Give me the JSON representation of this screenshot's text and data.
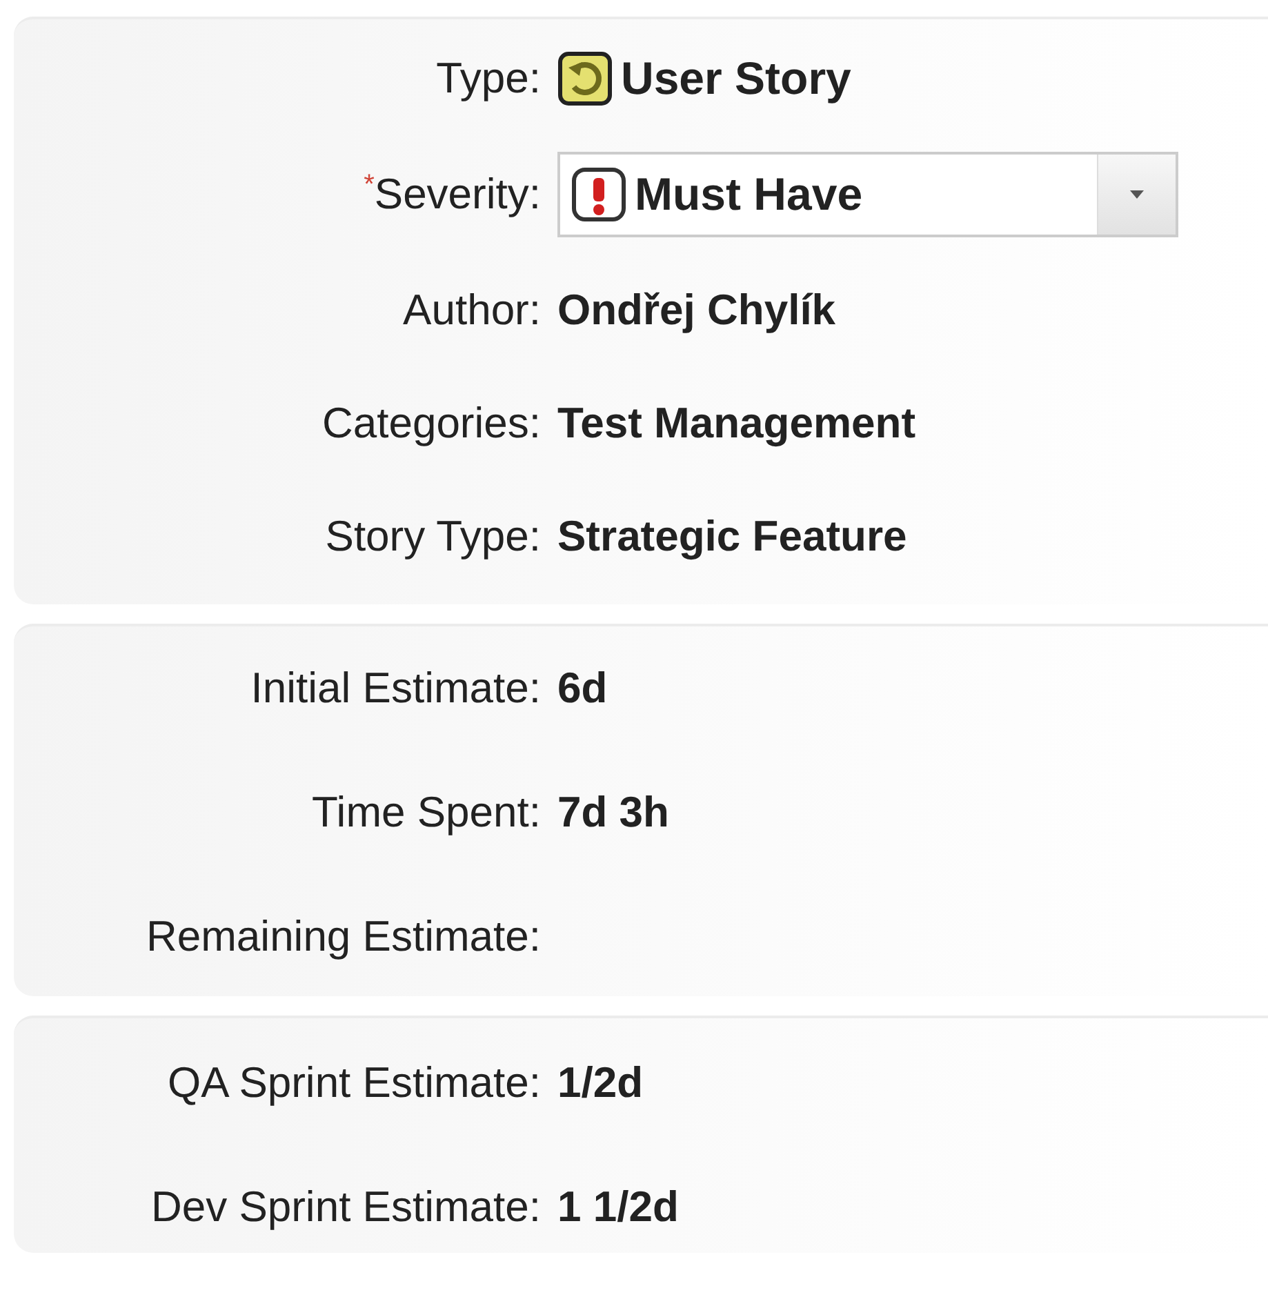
{
  "sections": [
    {
      "fields": [
        {
          "kind": "type",
          "label": "Type:",
          "required": false,
          "value": "User Story"
        },
        {
          "kind": "select",
          "label": "Severity:",
          "required": true,
          "value": "Must Have"
        },
        {
          "kind": "text",
          "label": "Author:",
          "required": false,
          "value": "Ondřej Chylík"
        },
        {
          "kind": "text",
          "label": "Categories:",
          "required": false,
          "value": "Test Management"
        },
        {
          "kind": "text",
          "label": "Story Type:",
          "required": false,
          "value": "Strategic Feature"
        }
      ]
    },
    {
      "fields": [
        {
          "kind": "text",
          "label": "Initial Estimate:",
          "required": false,
          "value": "6d"
        },
        {
          "kind": "text",
          "label": "Time Spent:",
          "required": false,
          "value": "7d 3h"
        },
        {
          "kind": "text",
          "label": "Remaining Estimate:",
          "required": false
        }
      ]
    },
    {
      "fields": [
        {
          "kind": "text",
          "label": "QA Sprint Estimate:",
          "required": false,
          "value": "1/2d"
        },
        {
          "kind": "text",
          "label": "Dev Sprint Estimate:",
          "required": false,
          "value": "1 1/2d"
        }
      ]
    }
  ],
  "required_mark": "*"
}
